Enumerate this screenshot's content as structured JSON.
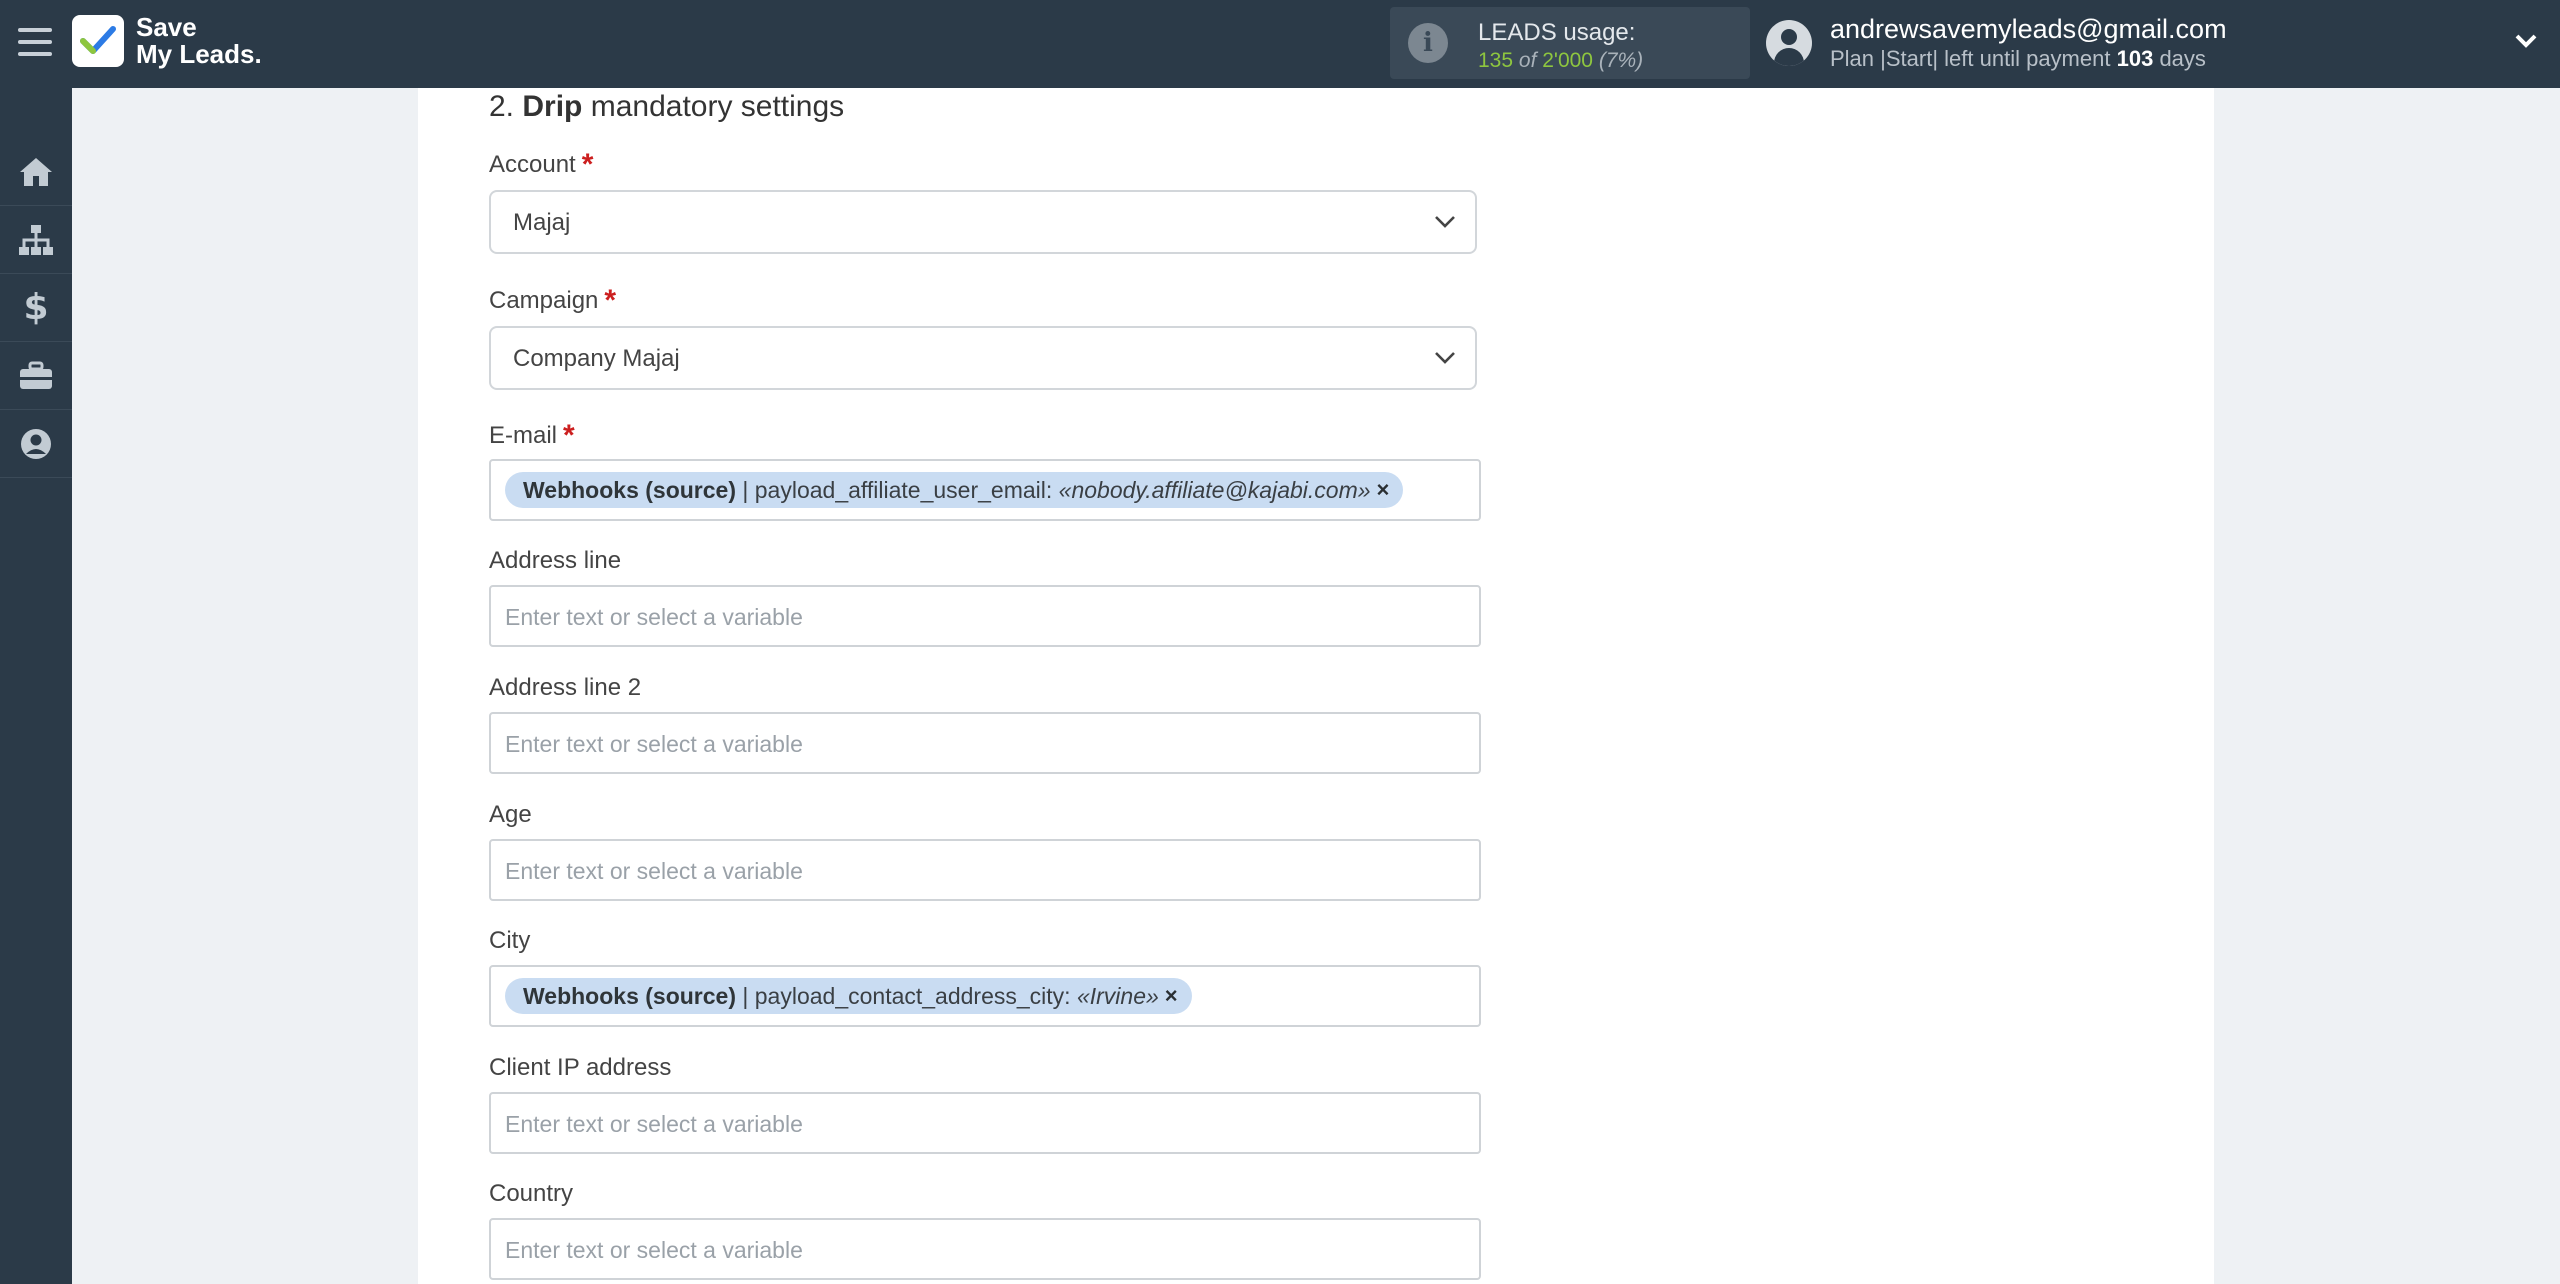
{
  "app": {
    "brand_line1": "Save",
    "brand_line2": "My Leads."
  },
  "usage": {
    "title": "LEADS usage:",
    "used": "135",
    "of": "of",
    "total": "2'000",
    "percent": "(7%)"
  },
  "user": {
    "email": "andrewsavemyleads@gmail.com",
    "plan_prefix": "Plan |Start| left until payment",
    "days_count": "103",
    "days_label": "days"
  },
  "sidebar": {
    "items": [
      "home-icon",
      "sitemap-icon",
      "dollar-icon",
      "briefcase-icon",
      "user-circle-icon"
    ]
  },
  "section": {
    "number": "2.",
    "name": "Drip",
    "rest": "mandatory settings"
  },
  "fields": {
    "account": {
      "label": "Account",
      "required_mark": "*",
      "value": "Majaj"
    },
    "campaign": {
      "label": "Campaign",
      "required_mark": "*",
      "value": "Company Majaj"
    },
    "email": {
      "label": "E-mail",
      "required_mark": "*",
      "chip_source": "Webhooks (source)",
      "chip_field": "| payload_affiliate_user_email:",
      "chip_value": "«nobody.affiliate@kajabi.com»",
      "chip_remove": "×"
    },
    "address_line": {
      "label": "Address line",
      "placeholder": "Enter text or select a variable"
    },
    "address_line_2": {
      "label": "Address line 2",
      "placeholder": "Enter text or select a variable"
    },
    "age": {
      "label": "Age",
      "placeholder": "Enter text or select a variable"
    },
    "city": {
      "label": "City",
      "chip_source": "Webhooks (source)",
      "chip_field": "| payload_contact_address_city:",
      "chip_value": "«Irvine»",
      "chip_remove": "×"
    },
    "client_ip": {
      "label": "Client IP address",
      "placeholder": "Enter text or select a variable"
    },
    "country": {
      "label": "Country",
      "placeholder": "Enter text or select a variable"
    }
  }
}
